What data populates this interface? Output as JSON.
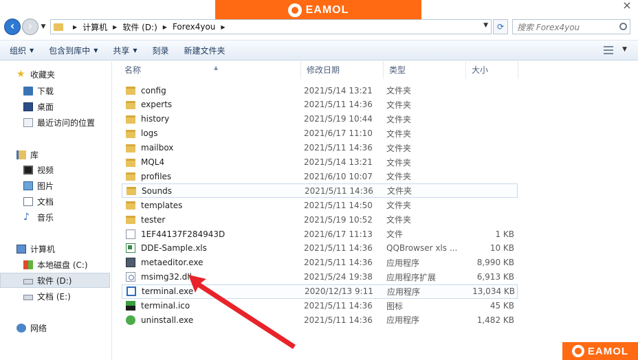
{
  "brand": {
    "name": "EAMOL"
  },
  "address": {
    "crumbs": [
      "计算机",
      "软件 (D:)",
      "Forex4you"
    ],
    "search_placeholder": "搜索 Forex4you"
  },
  "toolbar": {
    "organize": "组织",
    "include_in_library": "包含到库中",
    "share": "共享",
    "burn": "刻录",
    "new_folder": "新建文件夹"
  },
  "nav": {
    "favorites": "收藏夹",
    "downloads": "下载",
    "desktop": "桌面",
    "recent": "最近访问的位置",
    "libraries": "库",
    "videos": "视频",
    "pictures": "图片",
    "documents": "文档",
    "music": "音乐",
    "computer": "计算机",
    "local_disk": "本地磁盘 (C:)",
    "software": "软件 (D:)",
    "docs_drive": "文档 (E:)",
    "network": "网络"
  },
  "columns": {
    "name": "名称",
    "modified": "修改日期",
    "type": "类型",
    "size": "大小"
  },
  "files": [
    {
      "name": "config",
      "date": "2021/5/14 13:21",
      "type": "文件夹",
      "size": "",
      "icon": "folder-icon"
    },
    {
      "name": "experts",
      "date": "2021/5/11 14:36",
      "type": "文件夹",
      "size": "",
      "icon": "folder-icon"
    },
    {
      "name": "history",
      "date": "2021/5/19 10:44",
      "type": "文件夹",
      "size": "",
      "icon": "folder-icon"
    },
    {
      "name": "logs",
      "date": "2021/6/17 11:10",
      "type": "文件夹",
      "size": "",
      "icon": "folder-icon"
    },
    {
      "name": "mailbox",
      "date": "2021/5/11 14:36",
      "type": "文件夹",
      "size": "",
      "icon": "folder-icon"
    },
    {
      "name": "MQL4",
      "date": "2021/5/14 13:21",
      "type": "文件夹",
      "size": "",
      "icon": "folder-icon"
    },
    {
      "name": "profiles",
      "date": "2021/6/10 10:07",
      "type": "文件夹",
      "size": "",
      "icon": "folder-icon"
    },
    {
      "name": "Sounds",
      "date": "2021/5/11 14:36",
      "type": "文件夹",
      "size": "",
      "icon": "folder-icon"
    },
    {
      "name": "templates",
      "date": "2021/5/11 14:50",
      "type": "文件夹",
      "size": "",
      "icon": "folder-icon"
    },
    {
      "name": "tester",
      "date": "2021/5/19 10:52",
      "type": "文件夹",
      "size": "",
      "icon": "folder-icon"
    },
    {
      "name": "1EF44137F284943D",
      "date": "2021/6/17 11:13",
      "type": "文件",
      "size": "1 KB",
      "icon": "file-icon"
    },
    {
      "name": "DDE-Sample.xls",
      "date": "2021/5/11 14:36",
      "type": "QQBrowser xls ...",
      "size": "10 KB",
      "icon": "xls-icon"
    },
    {
      "name": "metaeditor.exe",
      "date": "2021/5/11 14:36",
      "type": "应用程序",
      "size": "8,990 KB",
      "icon": "exe-icon"
    },
    {
      "name": "msimg32.dll",
      "date": "2021/5/24 19:38",
      "type": "应用程序扩展",
      "size": "6,913 KB",
      "icon": "dll-icon"
    },
    {
      "name": "terminal.exe",
      "date": "2020/12/13 9:11",
      "type": "应用程序",
      "size": "13,034 KB",
      "icon": "terminal-icon"
    },
    {
      "name": "terminal.ico",
      "date": "2021/5/11 14:36",
      "type": "图标",
      "size": "45 KB",
      "icon": "ico-icon"
    },
    {
      "name": "uninstall.exe",
      "date": "2021/5/11 14:36",
      "type": "应用程序",
      "size": "1,482 KB",
      "icon": "uninstall-icon"
    }
  ],
  "colors": {
    "accent": "#ff6a13",
    "arrow": "#e8232a"
  }
}
